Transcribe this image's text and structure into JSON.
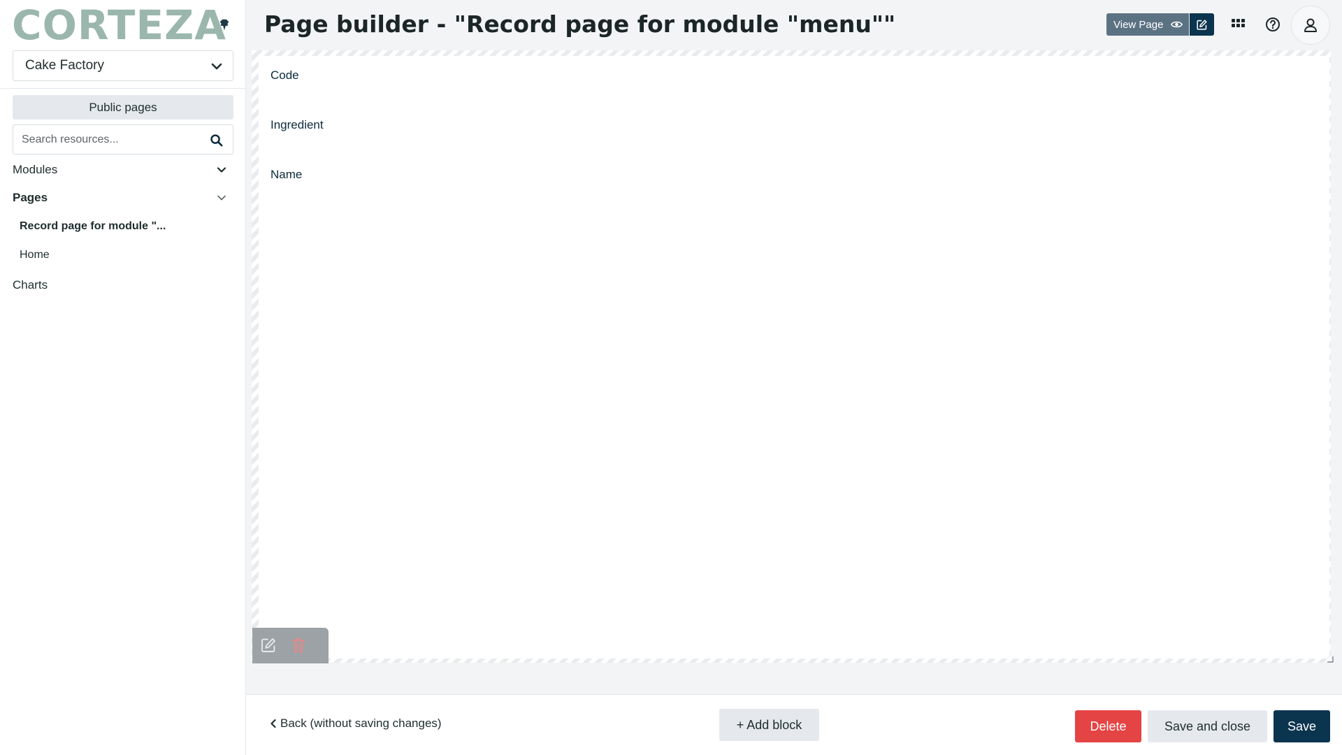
{
  "sidebar": {
    "logo": "CORTEZA",
    "namespace": "Cake Factory",
    "public_pages_label": "Public pages",
    "search_placeholder": "Search resources...",
    "sections": {
      "modules": "Modules",
      "pages": "Pages",
      "charts": "Charts"
    },
    "pages_items": [
      "Record page for module \"...",
      "Home"
    ]
  },
  "header": {
    "title": "Page builder - \"Record page for module \"menu\"\"",
    "view_page_label": "View Page"
  },
  "canvas": {
    "fields": [
      "Code",
      "Ingredient",
      "Name"
    ]
  },
  "footer": {
    "back_label": "Back (without saving changes)",
    "add_block_label": "+ Add block",
    "delete_label": "Delete",
    "save_close_label": "Save and close",
    "save_label": "Save"
  },
  "colors": {
    "primary": "#0b344e",
    "secondary": "#5b7283",
    "danger": "#e54444",
    "logo": "#9bb7ad",
    "light_button": "#e5e9ee"
  }
}
